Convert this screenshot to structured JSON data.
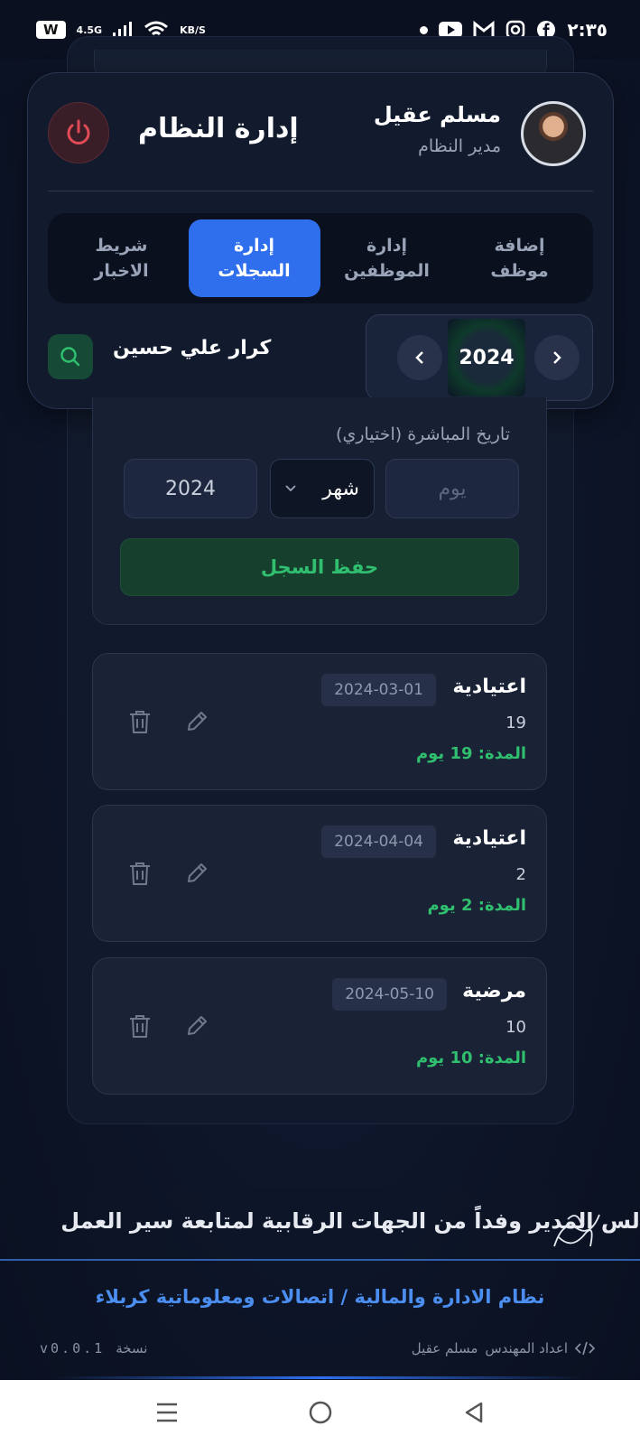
{
  "status_bar": {
    "time": "٢:٣٥",
    "network": "4.5G",
    "speed_unit": "KB/S",
    "badge": "W"
  },
  "header": {
    "user_name": "مسلم عقيل",
    "user_role": "مدير النظام",
    "system_title": "إدارة النظام"
  },
  "tabs": [
    {
      "label": "إضافة\nموظف",
      "active": false
    },
    {
      "label": "إدارة\nالموظفين",
      "active": false
    },
    {
      "label": "إدارة\nالسجلات",
      "active": true
    },
    {
      "label": "شريط\nالاخبار",
      "active": false
    }
  ],
  "year_selector": {
    "year": "2024"
  },
  "employee": {
    "name": "كرار علي حسين"
  },
  "form": {
    "date_label": "تاريخ المباشرة (اختياري)",
    "day_placeholder": "يوم",
    "month_value": "شهر",
    "year_value": "2024",
    "save_label": "حفظ السجل"
  },
  "records": [
    {
      "type": "اعتيادية",
      "date": "2024-03-01",
      "days": "19",
      "duration": "المدة: 19 يوم"
    },
    {
      "type": "اعتيادية",
      "date": "2024-04-04",
      "days": "2",
      "duration": "المدة: 2 يوم"
    },
    {
      "type": "مرضية",
      "date": "2024-05-10",
      "days": "10",
      "duration": "المدة: 10 يوم"
    }
  ],
  "ticker": {
    "text": "الس المدير وفداً من الجهات الرقابية لمتابعة سير العمل"
  },
  "footer": {
    "title": "نظام الادارة والمالية / اتصالات ومعلوماتية كربلاء",
    "credit_prefix": "اعداد المهندس",
    "credit_name": "مسلم عقيل",
    "version_label": "نسخة",
    "version": "v0.0.1"
  },
  "colors": {
    "accent": "#2f6fed",
    "success": "#2fbf6e",
    "danger": "#e04b55",
    "background": "#0d1528"
  }
}
